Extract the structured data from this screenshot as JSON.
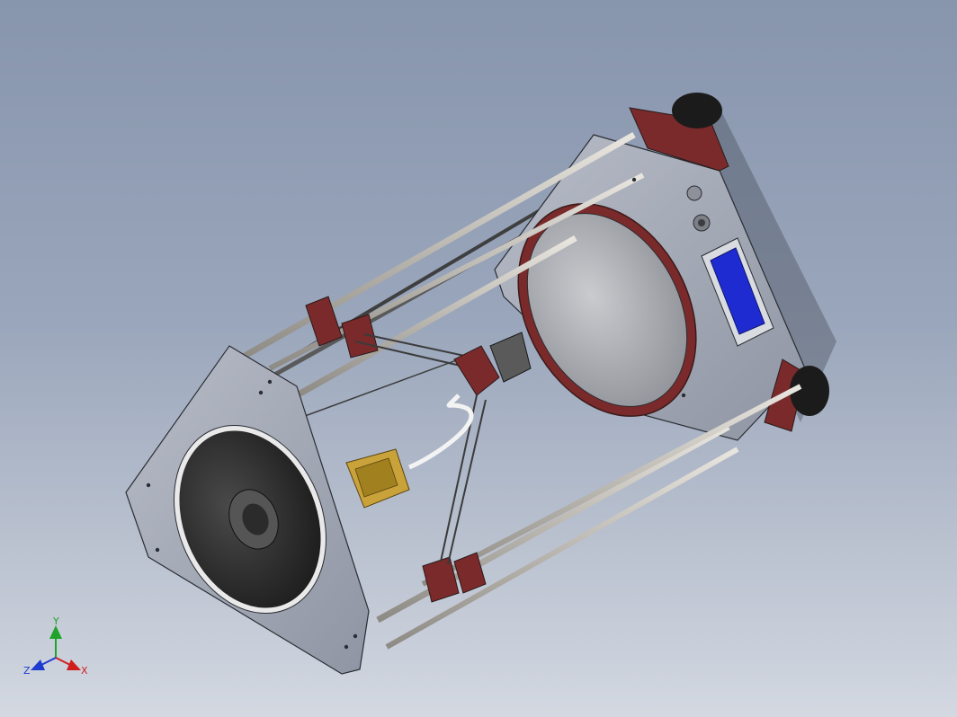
{
  "viewport": {
    "background_top": "#8795ad",
    "background_bottom": "#d3d8e1"
  },
  "model": {
    "frame_plate_color": "#a7acb8",
    "bracket_color": "#7a2a2a",
    "rod_color": "#c9c3bb",
    "spool_color": "#2b2b2b",
    "extruder_color": "#c9a23a",
    "lcd_color": "#1e2bd0"
  },
  "triad": {
    "x_label": "X",
    "y_label": "Y",
    "z_label": "Z",
    "x_color": "#d01e1e",
    "y_color": "#1fa32b",
    "z_color": "#1e3bd0"
  }
}
